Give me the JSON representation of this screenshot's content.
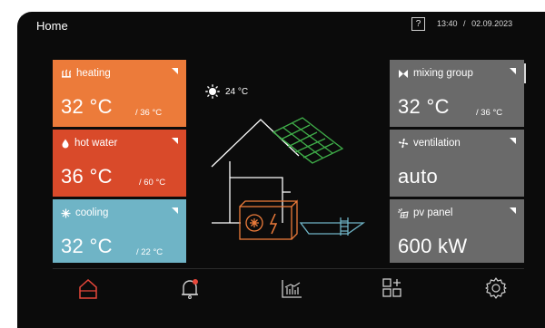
{
  "header": {
    "title": "Home",
    "help_label": "?",
    "time": "13:40",
    "separator": "/",
    "date": "02.09.2023"
  },
  "weather": {
    "temperature": "24 °C",
    "icon": "sun-icon"
  },
  "tiles": {
    "heating": {
      "label": "heating",
      "value": "32 °C",
      "setpoint": "/ 36 °C",
      "icon": "heating-icon",
      "color": "#ec7b3a"
    },
    "hot_water": {
      "label": "hot water",
      "value": "36 °C",
      "setpoint": "/ 60 °C",
      "icon": "water-drop-icon",
      "color": "#d94a2a"
    },
    "cooling": {
      "label": "cooling",
      "value": "32 °C",
      "setpoint": "/ 22 °C",
      "icon": "snowflake-icon",
      "color": "#6fb4c6"
    },
    "mixing_group": {
      "label": "mixing group",
      "value": "32 °C",
      "setpoint": "/ 36 °C",
      "icon": "mixer-fan-icon",
      "color": "#6a6a6a"
    },
    "ventilation": {
      "label": "ventilation",
      "value": "auto",
      "icon": "fan-icon",
      "color": "#6a6a6a"
    },
    "pv_panel": {
      "label": "pv panel",
      "value": "600 kW",
      "icon": "solar-icon",
      "color": "#6a6a6a"
    }
  },
  "illustration": {
    "roof_panel_color": "#3fae49",
    "pump_color": "#ec7b3a",
    "pool_color": "#6fb4c6",
    "house_color": "#ffffff"
  },
  "nav": [
    {
      "name": "home",
      "icon": "home-icon",
      "active": true,
      "color": "#e8473a"
    },
    {
      "name": "alarms",
      "icon": "bell-icon",
      "badge_color": "#e8473a"
    },
    {
      "name": "statistics",
      "icon": "chart-icon"
    },
    {
      "name": "add-widget",
      "icon": "add-widget-icon"
    },
    {
      "name": "settings",
      "icon": "gear-icon"
    }
  ]
}
